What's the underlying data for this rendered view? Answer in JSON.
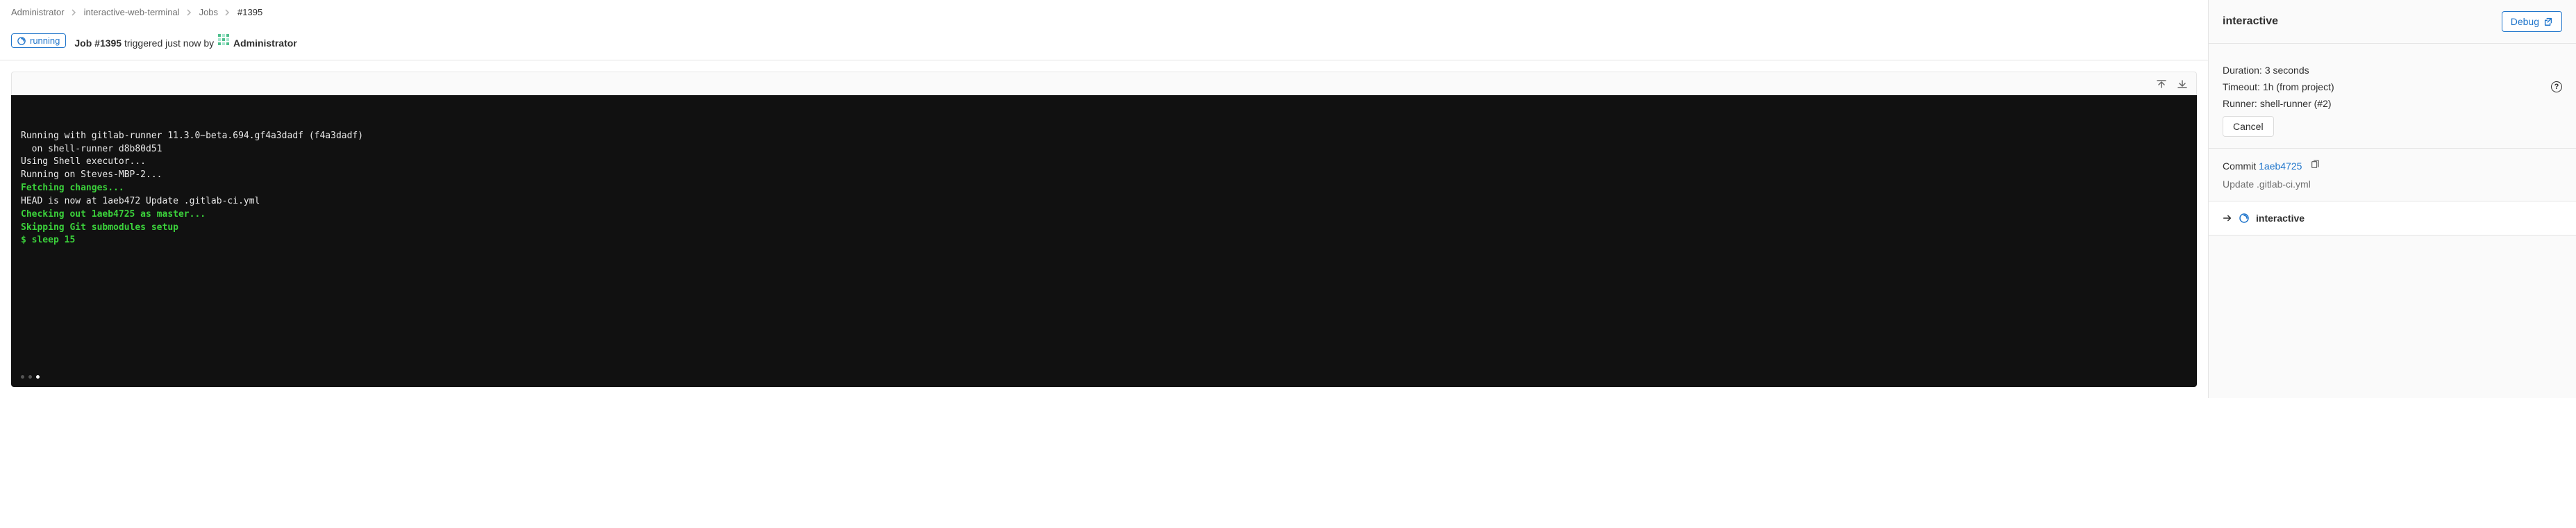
{
  "breadcrumbs": {
    "items": [
      {
        "label": "Administrator"
      },
      {
        "label": "interactive-web-terminal"
      },
      {
        "label": "Jobs"
      }
    ],
    "current": "#1395"
  },
  "status_badge": "running",
  "job": {
    "title_prefix": "Job #1395",
    "triggered_text": " triggered just now by ",
    "triggered_by": "Administrator"
  },
  "trace": {
    "lines": [
      {
        "text": "Running with gitlab-runner 11.3.0~beta.694.gf4a3dadf (f4a3dadf)",
        "cls": ""
      },
      {
        "text": "  on shell-runner d8b80d51",
        "cls": ""
      },
      {
        "text": "Using Shell executor...",
        "cls": ""
      },
      {
        "text": "Running on Steves-MBP-2...",
        "cls": ""
      },
      {
        "text": "Fetching changes...",
        "cls": "g"
      },
      {
        "text": "HEAD is now at 1aeb472 Update .gitlab-ci.yml",
        "cls": ""
      },
      {
        "text": "Checking out 1aeb4725 as master...",
        "cls": "g"
      },
      {
        "text": "Skipping Git submodules setup",
        "cls": "g"
      },
      {
        "text": "$ sleep 15",
        "cls": "g"
      }
    ]
  },
  "sidebar": {
    "job_name": "interactive",
    "debug_label": "Debug",
    "duration_label": "Duration:",
    "duration_value": "3 seconds",
    "timeout_label": "Timeout:",
    "timeout_value": "1h (from project)",
    "runner_label": "Runner:",
    "runner_value": "shell-runner (#2)",
    "cancel_label": "Cancel",
    "commit_label": "Commit",
    "commit_sha": "1aeb4725",
    "commit_message": "Update .gitlab-ci.yml",
    "stage_name": "interactive"
  }
}
